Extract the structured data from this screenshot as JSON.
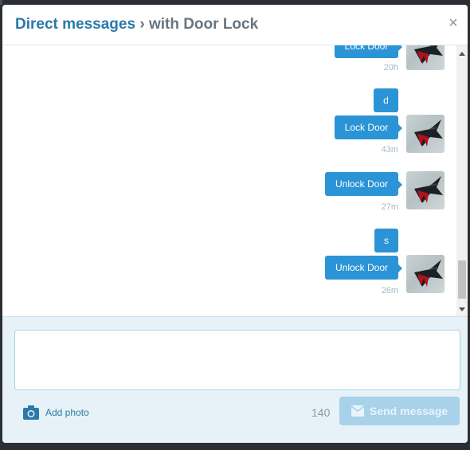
{
  "header": {
    "title_link": "Direct messages",
    "title_sep": " › ",
    "title_rest": "with Door Lock"
  },
  "messages": [
    {
      "text": "Lock Door",
      "time": "20h"
    },
    {
      "text": "d"
    },
    {
      "text": "Lock Door",
      "time": "43m"
    },
    {
      "text": "Unlock Door",
      "time": "27m"
    },
    {
      "text": "s"
    },
    {
      "text": "Unlock Door",
      "time": "26m"
    }
  ],
  "composer": {
    "add_photo_label": "Add photo",
    "char_count": "140",
    "send_label": "Send message"
  },
  "colors": {
    "bubble": "#2b94d6",
    "accent": "#2a7aa8",
    "composer_bg": "#e6f2f7",
    "send_disabled": "#a8d1ea"
  },
  "icons": [
    "close-icon",
    "camera-icon",
    "envelope-icon",
    "avatar-hummingbird"
  ]
}
